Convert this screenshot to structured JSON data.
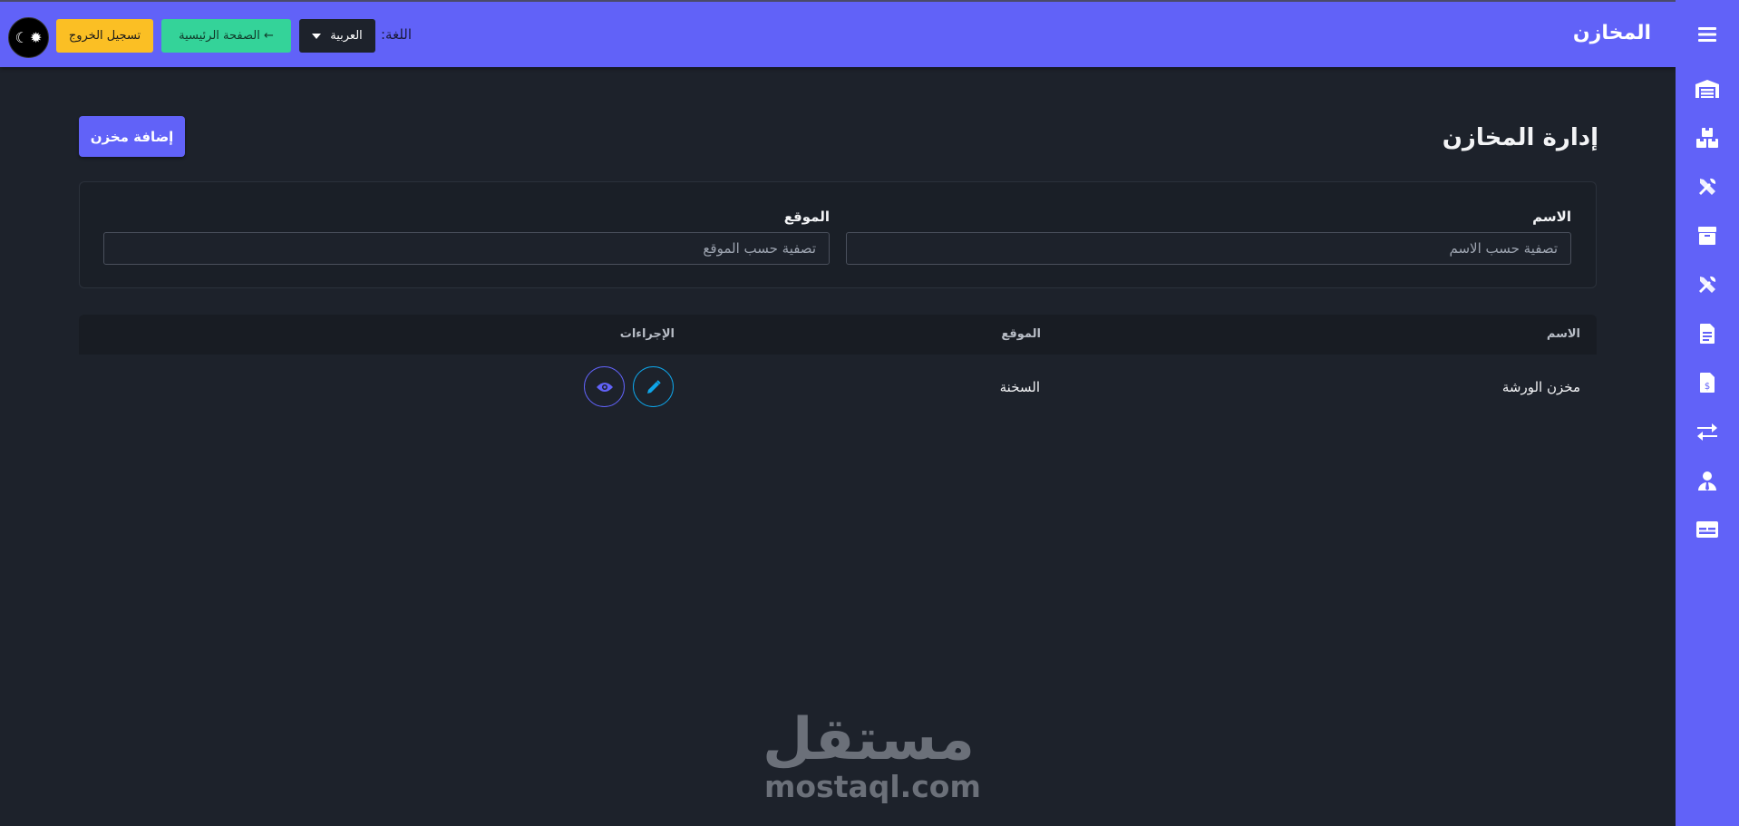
{
  "header": {
    "title": "المخازن",
    "language_label": "اللغة:",
    "language_value": "العربية",
    "home_label": "← الصفحة الرئيسية",
    "logout_label": "تسجيل الخروج",
    "theme_icons": [
      "moon-icon",
      "sun-icon"
    ]
  },
  "sidebar": {
    "items": [
      {
        "icon": "menu-icon"
      },
      {
        "icon": "warehouse-icon"
      },
      {
        "icon": "boxes-icon"
      },
      {
        "icon": "tools-icon"
      },
      {
        "icon": "box-open-icon"
      },
      {
        "icon": "tools-icon"
      },
      {
        "icon": "invoice-icon"
      },
      {
        "icon": "invoice-dollar-icon"
      },
      {
        "icon": "transfer-icon"
      },
      {
        "icon": "user-tie-icon"
      },
      {
        "icon": "id-card-icon"
      }
    ]
  },
  "main": {
    "title": "إدارة المخازن",
    "add_button": "إضافة مخزن",
    "filters": {
      "name_label": "الاسم",
      "name_placeholder": "تصفية حسب الاسم",
      "location_label": "الموقع",
      "location_placeholder": "تصفية حسب الموقع"
    },
    "table": {
      "columns": [
        "الاسم",
        "الموقع",
        "الإجراءات"
      ],
      "rows": [
        {
          "name": "مخزن الورشة",
          "location": "السخنة"
        }
      ]
    }
  },
  "watermark": {
    "arabic": "مستقل",
    "latin": "mostaql.com"
  },
  "colors": {
    "accent": "#6162f8",
    "background": "#1d222b",
    "logout": "#fbbf24",
    "home": "#34d399",
    "edit": "#0ea5e9"
  }
}
